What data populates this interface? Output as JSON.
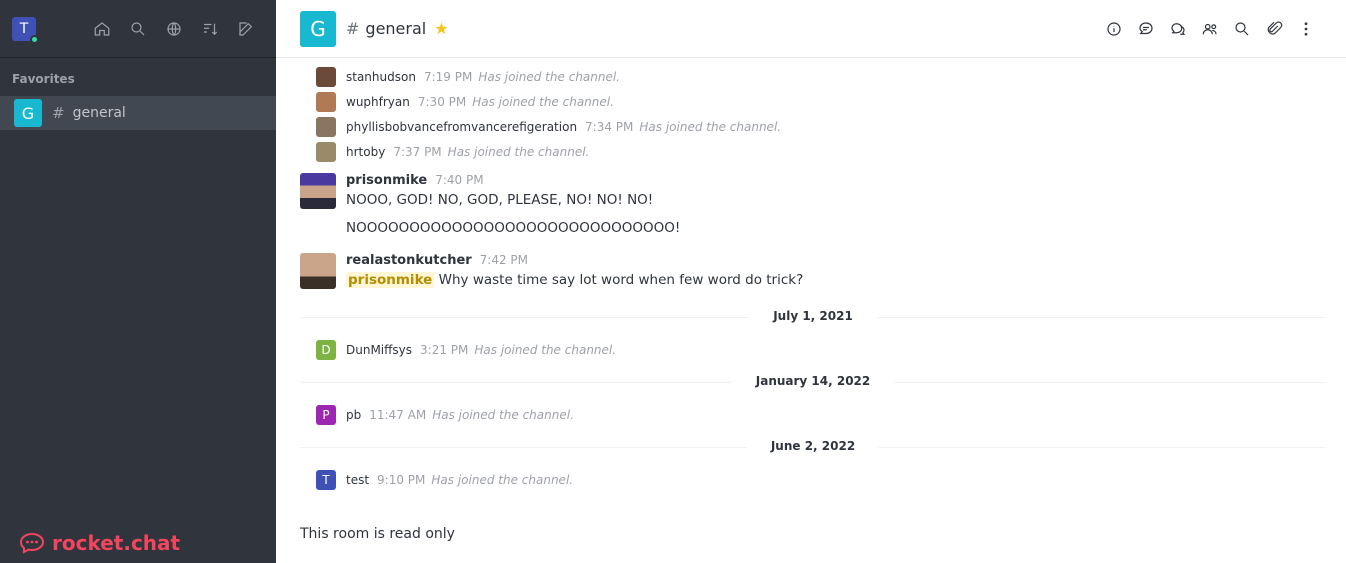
{
  "user": {
    "initial": "T"
  },
  "sidebar": {
    "section_favorites": "Favorites",
    "room": {
      "initial": "G",
      "name": "general"
    },
    "logo_text": "rocket.chat"
  },
  "header": {
    "initial": "G",
    "title": "general"
  },
  "messages": {
    "sys1": {
      "user": "stanhudson",
      "time": "7:19 PM",
      "text": "Has joined the channel."
    },
    "sys2": {
      "user": "wuphfryan",
      "time": "7:30 PM",
      "text": "Has joined the channel."
    },
    "sys3": {
      "user": "phyllisbobvancefromvancerefigeration",
      "time": "7:34 PM",
      "text": "Has joined the channel."
    },
    "sys4": {
      "user": "hrtoby",
      "time": "7:37 PM",
      "text": "Has joined the channel."
    },
    "msg1": {
      "user": "prisonmike",
      "time": "7:40 PM",
      "line1": "NOOO, GOD! NO, GOD, PLEASE, NO! NO! NO!",
      "line2": "NOOOOOOOOOOOOOOOOOOOOOOOOOOOOOO!"
    },
    "msg2": {
      "user": "realastonkutcher",
      "time": "7:42 PM",
      "mention": "prisonmike",
      "text": "Why waste time say lot word when few word do trick?"
    },
    "date1": "July 1, 2021",
    "sys5": {
      "initial": "D",
      "user": "DunMiffsys",
      "time": "3:21 PM",
      "text": "Has joined the channel."
    },
    "date2": "January 14, 2022",
    "sys6": {
      "initial": "P",
      "user": "pb",
      "time": "11:47 AM",
      "text": "Has joined the channel."
    },
    "date3": "June 2, 2022",
    "sys7": {
      "initial": "T",
      "user": "test",
      "time": "9:10 PM",
      "text": "Has joined the channel."
    }
  },
  "footer": {
    "read_only": "This room is read only"
  }
}
